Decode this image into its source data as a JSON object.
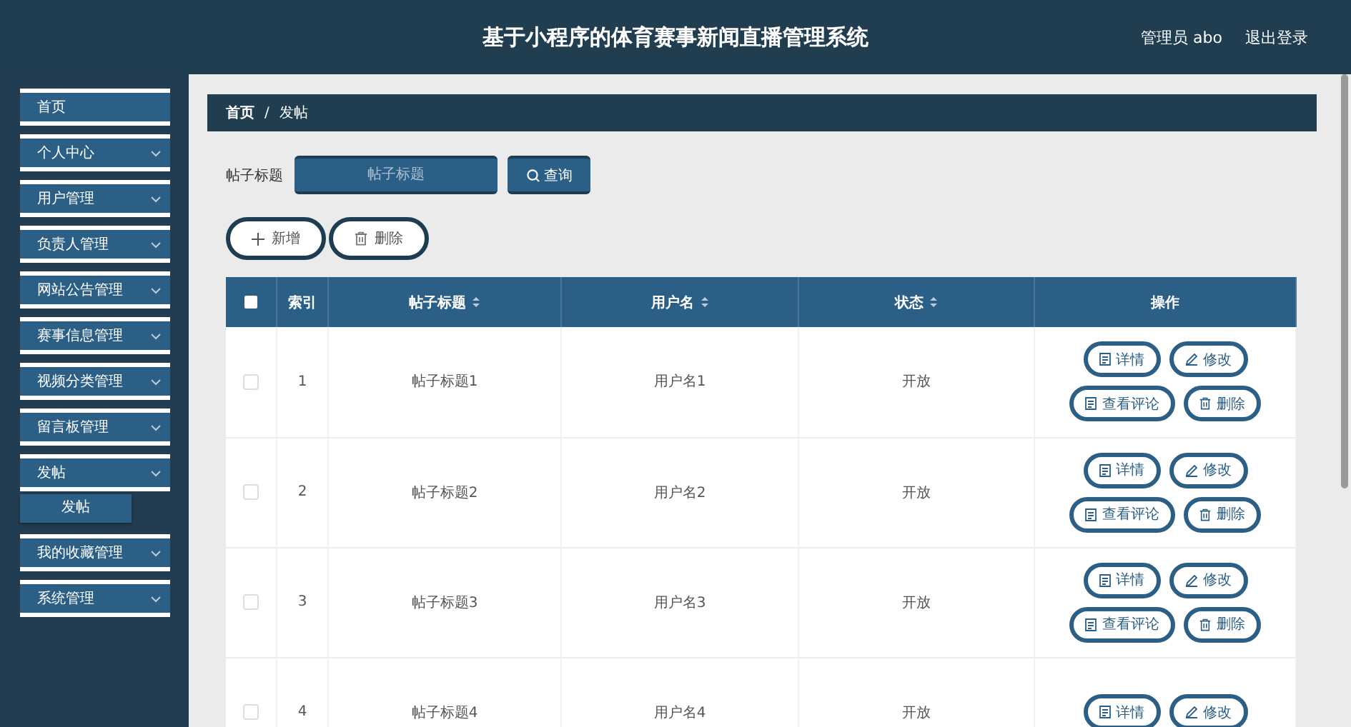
{
  "header": {
    "title": "基于小程序的体育赛事新闻直播管理系统",
    "user": "管理员 abo",
    "logout": "退出登录"
  },
  "sidebar": {
    "items": [
      {
        "kind": "link",
        "label": "首页"
      },
      {
        "kind": "submenu",
        "label": "个人中心"
      },
      {
        "kind": "submenu",
        "label": "用户管理"
      },
      {
        "kind": "submenu",
        "label": "负责人管理"
      },
      {
        "kind": "submenu",
        "label": "网站公告管理"
      },
      {
        "kind": "submenu",
        "label": "赛事信息管理"
      },
      {
        "kind": "submenu",
        "label": "视频分类管理"
      },
      {
        "kind": "submenu",
        "label": "留言板管理"
      },
      {
        "kind": "submenu",
        "label": "发帖",
        "children": [
          {
            "label": "发帖"
          }
        ]
      },
      {
        "kind": "submenu",
        "label": "我的收藏管理"
      },
      {
        "kind": "submenu",
        "label": "系统管理"
      }
    ]
  },
  "breadcrumb": {
    "separator": "/",
    "items": [
      "首页",
      "发帖"
    ]
  },
  "search": {
    "label": "帖子标题",
    "placeholder": "帖子标题",
    "button": "查询"
  },
  "toolbar": [
    {
      "kind": "add",
      "label": "新增"
    },
    {
      "kind": "delete",
      "label": "删除"
    }
  ],
  "table": {
    "header_checked": false,
    "columns": [
      {
        "label": "索引",
        "sortable": false
      },
      {
        "label": "帖子标题",
        "sortable": true
      },
      {
        "label": "用户名",
        "sortable": true
      },
      {
        "label": "状态",
        "sortable": true
      },
      {
        "label": "操作",
        "sortable": false
      }
    ],
    "rows": [
      {
        "checked": false,
        "cells": [
          "1",
          "帖子标题1",
          "用户名1",
          "开放"
        ],
        "actions": [
          {
            "kind": "detail",
            "label": "详情"
          },
          {
            "kind": "edit",
            "label": "修改"
          },
          {
            "kind": "detail",
            "label": "查看评论"
          },
          {
            "kind": "delete",
            "label": "删除"
          }
        ]
      },
      {
        "checked": false,
        "cells": [
          "2",
          "帖子标题2",
          "用户名2",
          "开放"
        ],
        "actions": [
          {
            "kind": "detail",
            "label": "详情"
          },
          {
            "kind": "edit",
            "label": "修改"
          },
          {
            "kind": "detail",
            "label": "查看评论"
          },
          {
            "kind": "delete",
            "label": "删除"
          }
        ]
      },
      {
        "checked": false,
        "cells": [
          "3",
          "帖子标题3",
          "用户名3",
          "开放"
        ],
        "actions": [
          {
            "kind": "detail",
            "label": "详情"
          },
          {
            "kind": "edit",
            "label": "修改"
          },
          {
            "kind": "detail",
            "label": "查看评论"
          },
          {
            "kind": "delete",
            "label": "删除"
          }
        ]
      },
      {
        "checked": false,
        "cells": [
          "4",
          "帖子标题4",
          "用户名4",
          "开放"
        ],
        "actions": [
          {
            "kind": "detail",
            "label": "详情"
          },
          {
            "kind": "edit",
            "label": "修改"
          }
        ]
      }
    ]
  }
}
